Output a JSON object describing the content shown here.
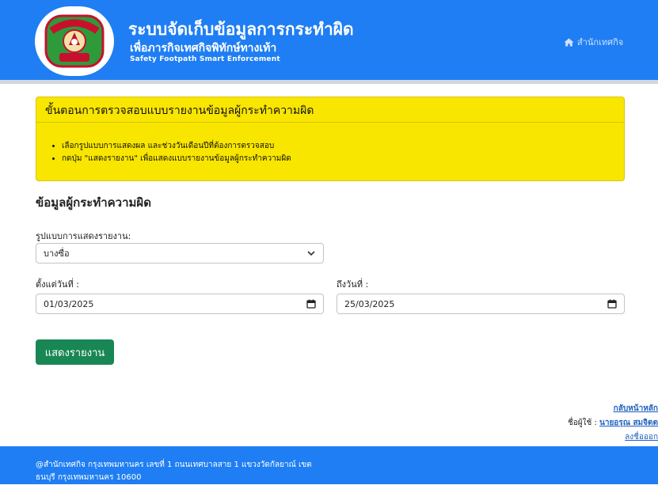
{
  "header": {
    "title": "ระบบจัดเก็บข้อมูลการกระทำผิด",
    "subtitle": "เพื่อภารกิจเทศกิจพิทักษ์ทางเท้า",
    "subtitle_en": "Safety Footpath Smart Enforcement",
    "office_link": "สำนักเทศกิจ",
    "colors": {
      "brand": "#1f7ef3"
    }
  },
  "logo": {
    "text_top": "กรุงเทพมหานคร",
    "text_bottom": "เทศกิจ"
  },
  "instructions": {
    "title": "ขั้นตอนการตรวจสอบแบบรายงานข้อมูลผู้กระทำความผิด",
    "steps": [
      "เลือกรูปแบบการแสดงผล และช่วงวันเดือนปีที่ต้องการตรวจสอบ",
      "กดปุ่ม \"แสดงรายงาน\" เพื่อแสดงแบบรายงานข้อมูลผู้กระทำความผิด"
    ],
    "colors": {
      "background": "#f9e600"
    }
  },
  "form": {
    "section_title": "ข้อมูลผู้กระทำความผิด",
    "report_type_label": "รูปแบบการแสดงรายงาน:",
    "report_type_value": "บางซื่อ",
    "from_label": "ตั้งแต่วันที่ :",
    "from_value": "01/03/2025",
    "to_label": "ถึงวันที่ :",
    "to_value": "25/03/2025",
    "submit_label": "แสดงรายงาน",
    "colors": {
      "submit": "#198754"
    }
  },
  "user_panel": {
    "home_link": "กลับหน้าหลัก",
    "user_label": "ชื่อผู้ใช้ :",
    "user_name": "นายอรุณ สมจิตต",
    "logout_link": "ลงชื่อออก"
  },
  "footer": {
    "line1": "@สำนักเทศกิจ กรุงเทพมหานคร เลขที่ 1 ถนนเทศบาลสาย 1 แขวงวัดกัลยาณ์ เขต",
    "line2": "ธนบุรี กรุงเทพมหานคร 10600"
  }
}
